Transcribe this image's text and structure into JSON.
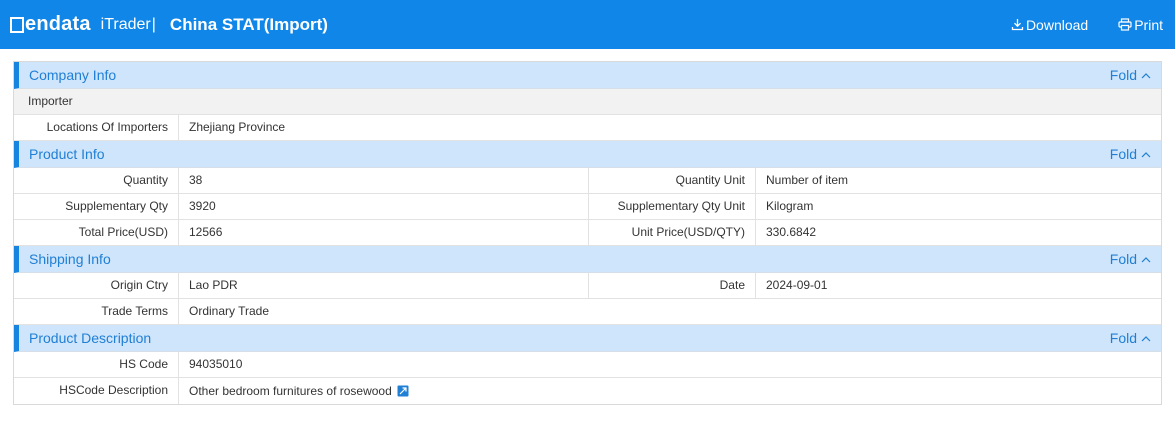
{
  "header": {
    "logo_text": "endata",
    "product": "iTrader",
    "separator": "|",
    "title": "China STAT(Import)",
    "download_label": "Download",
    "print_label": "Print"
  },
  "fold_label": "Fold",
  "company": {
    "title": "Company Info",
    "subheader": "Importer",
    "rows": [
      {
        "label": "Locations Of Importers",
        "value": "Zhejiang Province"
      }
    ]
  },
  "product": {
    "title": "Product Info",
    "rows": [
      {
        "l_label": "Quantity",
        "l_value": "38",
        "r_label": "Quantity Unit",
        "r_value": "Number of item"
      },
      {
        "l_label": "Supplementary Qty",
        "l_value": "3920",
        "r_label": "Supplementary Qty Unit",
        "r_value": "Kilogram"
      },
      {
        "l_label": "Total Price(USD)",
        "l_value": "12566",
        "r_label": "Unit Price(USD/QTY)",
        "r_value": "330.6842"
      }
    ]
  },
  "shipping": {
    "title": "Shipping Info",
    "rows": [
      {
        "l_label": "Origin Ctry",
        "l_value": "Lao PDR",
        "r_label": "Date",
        "r_value": "2024-09-01"
      }
    ],
    "trade_label": "Trade Terms",
    "trade_value": "Ordinary Trade"
  },
  "description": {
    "title": "Product Description",
    "hs_label": "HS Code",
    "hs_value": "94035010",
    "desc_label": "HSCode Description",
    "desc_value": "Other bedroom furnitures of rosewood"
  },
  "colors": {
    "header_bg": "#0f86e8",
    "section_bg": "#cfe5fb",
    "accent": "#1f7fd5"
  }
}
